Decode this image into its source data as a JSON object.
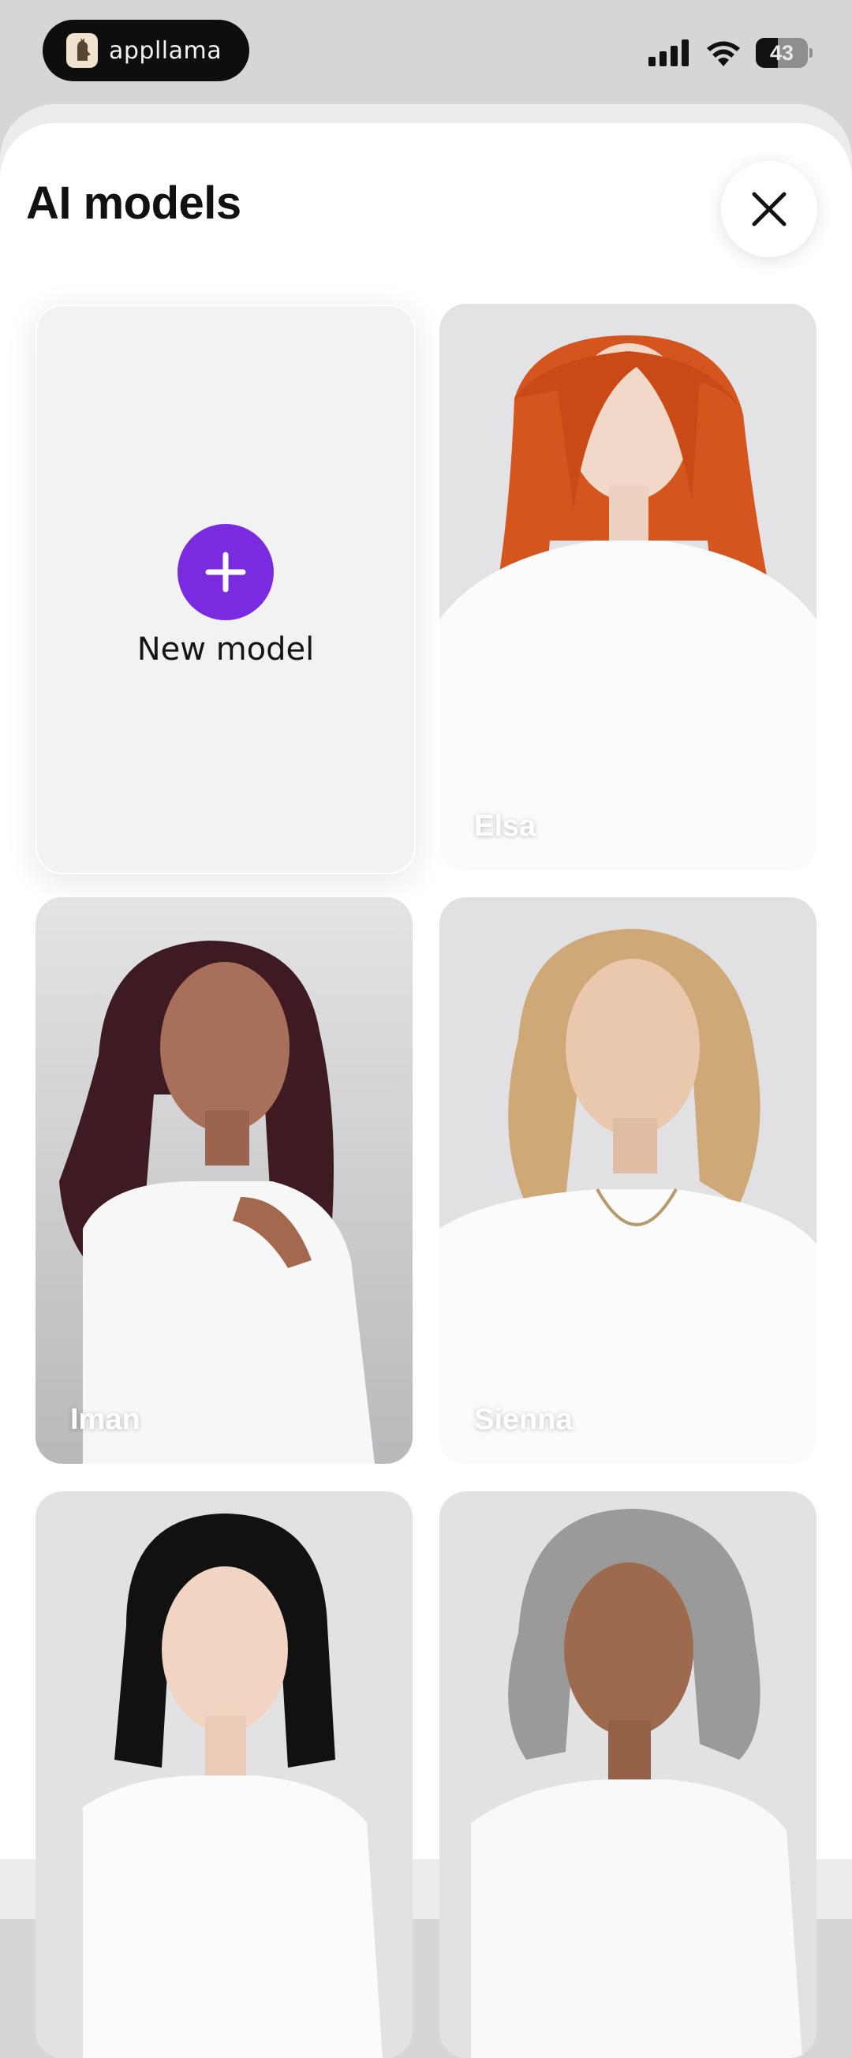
{
  "status_bar": {
    "brand": "appllama",
    "battery": "43",
    "battery_level": 0.43,
    "icons": [
      "cellular-signal-icon",
      "wifi-icon",
      "battery-icon"
    ]
  },
  "header": {
    "title": "AI models",
    "close_icon": "close-icon"
  },
  "new_model": {
    "label": "New model",
    "icon": "plus-icon",
    "accent": "#7a2be0"
  },
  "models": [
    {
      "name": "Elsa",
      "hair_color": "#d4561e"
    },
    {
      "name": "Iman",
      "hair_color": "#3e1a22"
    },
    {
      "name": "Sienna",
      "hair_color": "#cfa878"
    },
    {
      "name": "",
      "hair_color": "#111111"
    },
    {
      "name": "",
      "hair_color": "#9a9a9a"
    }
  ]
}
